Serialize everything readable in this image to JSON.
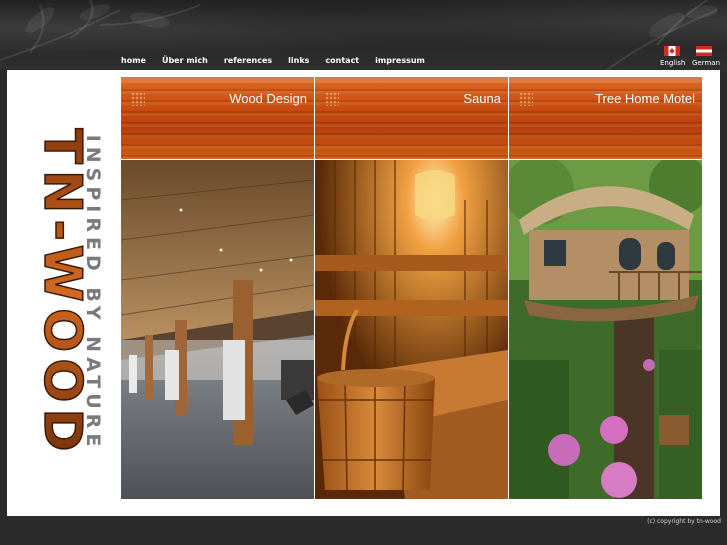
{
  "nav": {
    "items": [
      {
        "label": "home"
      },
      {
        "label": "Über mich"
      },
      {
        "label": "references"
      },
      {
        "label": "links"
      },
      {
        "label": "contact"
      },
      {
        "label": "impressum"
      }
    ]
  },
  "languages": [
    {
      "label": "English",
      "flag": "canada-flag-icon"
    },
    {
      "label": "German",
      "flag": "austria-flag-icon"
    }
  ],
  "brand": {
    "logo_text": "TN-WOOD",
    "tagline": "INSPIRED BY NATURE",
    "logo_color": "#c85a18",
    "tagline_color": "#7a7a7a"
  },
  "sections": [
    {
      "title": "Wood Design"
    },
    {
      "title": "Sauna"
    },
    {
      "title": "Tree Home Motel"
    }
  ],
  "footer": {
    "copyright": "(c) copyright by tn-wood"
  },
  "colors": {
    "accent": "#d2561a",
    "background": "#2b2b2b"
  }
}
